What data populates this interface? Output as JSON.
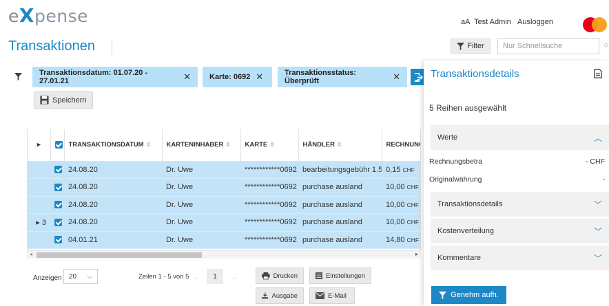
{
  "header": {
    "logo_prefix": "e",
    "logo_x": "X",
    "logo_suffix": "pense",
    "font_size_label": "aA",
    "user": "Test Admin",
    "logout": "Ausloggen"
  },
  "page": {
    "title": "Transaktionen",
    "filter_label": "Filter",
    "search_placeholder": "Nur Schnellsuche"
  },
  "chips": [
    {
      "label": "Transaktionsdatum: 01.07.20 - 27.01.21"
    },
    {
      "label": "Karte: 0692"
    },
    {
      "label": "Transaktionsstatus: Überprüft"
    }
  ],
  "toolbar": {
    "save_label": "Speichern"
  },
  "table": {
    "columns": [
      "TRANSAKTIONSDATUM",
      "KARTENINHABER",
      "KARTE",
      "HÄNDLER",
      "RECHNUNGSBETRAG"
    ],
    "rows": [
      {
        "group": "",
        "date": "24.08.20",
        "holder": "Dr. Uwe",
        "card": "************0692",
        "merchant": "bearbeitungsgebühr 1.5",
        "amount": "0,15",
        "currency": "CHF"
      },
      {
        "group": "",
        "date": "24.08.20",
        "holder": "Dr. Uwe",
        "card": "************0692",
        "merchant": "purchase ausland",
        "amount": "10,00",
        "currency": "CHF"
      },
      {
        "group": "",
        "date": "24.08.20",
        "holder": "Dr. Uwe",
        "card": "************0692",
        "merchant": "purchase ausland",
        "amount": "10,00",
        "currency": "CHF"
      },
      {
        "group": "3",
        "date": "24.08.20",
        "holder": "Dr. Uwe",
        "card": "************0692",
        "merchant": "purchase ausland",
        "amount": "10,00",
        "currency": "CHF"
      },
      {
        "group": "",
        "date": "04.01.21",
        "holder": "Dr. Uwe",
        "card": "************0692",
        "merchant": "purchase ausland",
        "amount": "14,80",
        "currency": "CHF"
      }
    ]
  },
  "footer": {
    "show_label": "Anzeigen",
    "page_size": "20",
    "rows_info": "Zeilen 1 - 5 von 5",
    "current_page": "1",
    "print_label": "Drucken",
    "settings_label": "Einstellungen",
    "export_label": "Ausgabe",
    "email_label": "E-Mail"
  },
  "details_panel": {
    "title": "Transaktionsdetails",
    "selected_info": "5 Reihen ausgewählt",
    "sections": {
      "values": "Werte",
      "transaction_details": "Transaktionsdetails",
      "cost_distribution": "Kostenverteilung",
      "comments": "Kommentare"
    },
    "fields": [
      {
        "label": "Rechnungsbetra",
        "value": "- CHF"
      },
      {
        "label": "Originalwährung",
        "value": "-"
      }
    ],
    "approve_label": "Genehm aufh."
  },
  "colors": {
    "accent": "#1e88c7",
    "selected_row": "#c3e4f8",
    "chip": "#b7e1f8"
  }
}
